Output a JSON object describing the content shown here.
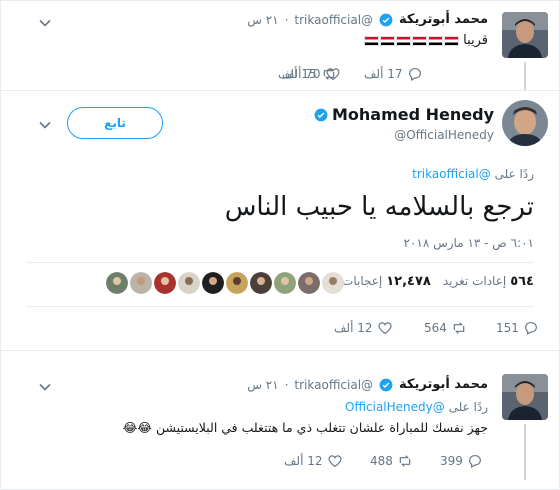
{
  "tweet1": {
    "author_name": "محمد أبوتريكة",
    "handle": "@trikaofficial",
    "time": "٢١ س",
    "text": "قريبا",
    "flags": 6,
    "replies": "17 ألف",
    "retweets": "15 ألف",
    "likes": "70 ألف"
  },
  "tweet2": {
    "author_name": "Mohamed Henedy",
    "handle": "@OfficialHenedy",
    "follow_label": "تابع",
    "reply_prefix": "ردًا على",
    "reply_to": "@trikaofficial",
    "text": "ترجع بالسلامه  يا حبيب الناس",
    "timestamp": "٦:٠١ ص - ١٣ مارس ٢٠١٨",
    "retweets_label": "إعادات تغريد",
    "retweets_count": "٥٦٤",
    "likes_label": "إعجابات",
    "likes_count": "١٢,٤٧٨",
    "replies": "151",
    "retweets": "564",
    "likes": "12 ألف"
  },
  "tweet3": {
    "author_name": "محمد أبوتريكة",
    "handle": "@trikaofficial",
    "time": "٢١ س",
    "reply_prefix": "ردًا على",
    "reply_to": "@OfficialHenedy",
    "text": "جهز نفسك للمباراة علشان تتغلب ذي ما هتتغلب في البلايستيشن",
    "emoji": "😂😂",
    "replies": "399",
    "retweets": "488",
    "likes": "12 ألف"
  },
  "colors": {
    "accent": "#1da1f2",
    "muted": "#657786",
    "border": "#e6ecf0"
  },
  "icons": [
    "reply-icon",
    "retweet-icon",
    "like-icon",
    "chevron-down-icon",
    "verified-badge-icon"
  ]
}
